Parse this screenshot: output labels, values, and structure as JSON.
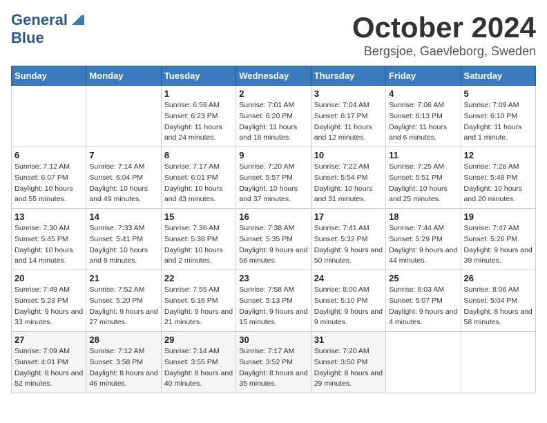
{
  "header": {
    "logo_line1": "General",
    "logo_line2": "Blue",
    "month": "October 2024",
    "location": "Bergsjoe, Gaevleborg, Sweden"
  },
  "weekdays": [
    "Sunday",
    "Monday",
    "Tuesday",
    "Wednesday",
    "Thursday",
    "Friday",
    "Saturday"
  ],
  "weeks": [
    [
      {
        "day": "",
        "info": ""
      },
      {
        "day": "",
        "info": ""
      },
      {
        "day": "1",
        "info": "Sunrise: 6:59 AM\nSunset: 6:23 PM\nDaylight: 11 hours and 24 minutes."
      },
      {
        "day": "2",
        "info": "Sunrise: 7:01 AM\nSunset: 6:20 PM\nDaylight: 11 hours and 18 minutes."
      },
      {
        "day": "3",
        "info": "Sunrise: 7:04 AM\nSunset: 6:17 PM\nDaylight: 11 hours and 12 minutes."
      },
      {
        "day": "4",
        "info": "Sunrise: 7:06 AM\nSunset: 6:13 PM\nDaylight: 11 hours and 6 minutes."
      },
      {
        "day": "5",
        "info": "Sunrise: 7:09 AM\nSunset: 6:10 PM\nDaylight: 11 hours and 1 minute."
      }
    ],
    [
      {
        "day": "6",
        "info": "Sunrise: 7:12 AM\nSunset: 6:07 PM\nDaylight: 10 hours and 55 minutes."
      },
      {
        "day": "7",
        "info": "Sunrise: 7:14 AM\nSunset: 6:04 PM\nDaylight: 10 hours and 49 minutes."
      },
      {
        "day": "8",
        "info": "Sunrise: 7:17 AM\nSunset: 6:01 PM\nDaylight: 10 hours and 43 minutes."
      },
      {
        "day": "9",
        "info": "Sunrise: 7:20 AM\nSunset: 5:57 PM\nDaylight: 10 hours and 37 minutes."
      },
      {
        "day": "10",
        "info": "Sunrise: 7:22 AM\nSunset: 5:54 PM\nDaylight: 10 hours and 31 minutes."
      },
      {
        "day": "11",
        "info": "Sunrise: 7:25 AM\nSunset: 5:51 PM\nDaylight: 10 hours and 25 minutes."
      },
      {
        "day": "12",
        "info": "Sunrise: 7:28 AM\nSunset: 5:48 PM\nDaylight: 10 hours and 20 minutes."
      }
    ],
    [
      {
        "day": "13",
        "info": "Sunrise: 7:30 AM\nSunset: 5:45 PM\nDaylight: 10 hours and 14 minutes."
      },
      {
        "day": "14",
        "info": "Sunrise: 7:33 AM\nSunset: 5:41 PM\nDaylight: 10 hours and 8 minutes."
      },
      {
        "day": "15",
        "info": "Sunrise: 7:36 AM\nSunset: 5:38 PM\nDaylight: 10 hours and 2 minutes."
      },
      {
        "day": "16",
        "info": "Sunrise: 7:38 AM\nSunset: 5:35 PM\nDaylight: 9 hours and 56 minutes."
      },
      {
        "day": "17",
        "info": "Sunrise: 7:41 AM\nSunset: 5:32 PM\nDaylight: 9 hours and 50 minutes."
      },
      {
        "day": "18",
        "info": "Sunrise: 7:44 AM\nSunset: 5:29 PM\nDaylight: 9 hours and 44 minutes."
      },
      {
        "day": "19",
        "info": "Sunrise: 7:47 AM\nSunset: 5:26 PM\nDaylight: 9 hours and 39 minutes."
      }
    ],
    [
      {
        "day": "20",
        "info": "Sunrise: 7:49 AM\nSunset: 5:23 PM\nDaylight: 9 hours and 33 minutes."
      },
      {
        "day": "21",
        "info": "Sunrise: 7:52 AM\nSunset: 5:20 PM\nDaylight: 9 hours and 27 minutes."
      },
      {
        "day": "22",
        "info": "Sunrise: 7:55 AM\nSunset: 5:16 PM\nDaylight: 9 hours and 21 minutes."
      },
      {
        "day": "23",
        "info": "Sunrise: 7:58 AM\nSunset: 5:13 PM\nDaylight: 9 hours and 15 minutes."
      },
      {
        "day": "24",
        "info": "Sunrise: 8:00 AM\nSunset: 5:10 PM\nDaylight: 9 hours and 9 minutes."
      },
      {
        "day": "25",
        "info": "Sunrise: 8:03 AM\nSunset: 5:07 PM\nDaylight: 9 hours and 4 minutes."
      },
      {
        "day": "26",
        "info": "Sunrise: 8:06 AM\nSunset: 5:04 PM\nDaylight: 8 hours and 58 minutes."
      }
    ],
    [
      {
        "day": "27",
        "info": "Sunrise: 7:09 AM\nSunset: 4:01 PM\nDaylight: 8 hours and 52 minutes."
      },
      {
        "day": "28",
        "info": "Sunrise: 7:12 AM\nSunset: 3:58 PM\nDaylight: 8 hours and 46 minutes."
      },
      {
        "day": "29",
        "info": "Sunrise: 7:14 AM\nSunset: 3:55 PM\nDaylight: 8 hours and 40 minutes."
      },
      {
        "day": "30",
        "info": "Sunrise: 7:17 AM\nSunset: 3:52 PM\nDaylight: 8 hours and 35 minutes."
      },
      {
        "day": "31",
        "info": "Sunrise: 7:20 AM\nSunset: 3:50 PM\nDaylight: 8 hours and 29 minutes."
      },
      {
        "day": "",
        "info": ""
      },
      {
        "day": "",
        "info": ""
      }
    ]
  ]
}
